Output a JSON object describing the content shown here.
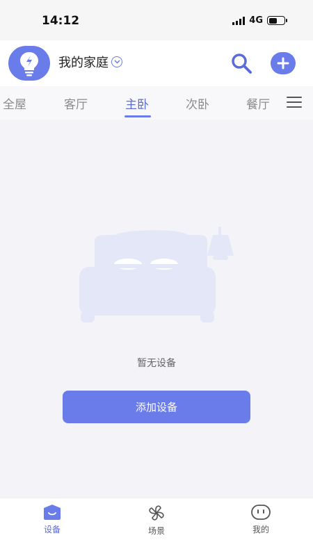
{
  "status_bar": {
    "time": "14:12",
    "network": "4G",
    "battery_level": 0.55
  },
  "header": {
    "home_name": "我的家庭"
  },
  "tabs": [
    {
      "label": "全屋",
      "active": false
    },
    {
      "label": "客厅",
      "active": false
    },
    {
      "label": "主卧",
      "active": true
    },
    {
      "label": "次卧",
      "active": false
    },
    {
      "label": "餐厅",
      "active": false
    }
  ],
  "empty_state": {
    "message": "暂无设备",
    "button_label": "添加设备"
  },
  "bottom_nav": [
    {
      "label": "设备",
      "icon": "device-icon",
      "active": true
    },
    {
      "label": "场景",
      "icon": "scene-icon",
      "active": false
    },
    {
      "label": "我的",
      "icon": "profile-icon",
      "active": false
    }
  ],
  "colors": {
    "accent": "#6a7bea",
    "active_text": "#5b6cd6",
    "illustration": "#e4e7f8"
  }
}
